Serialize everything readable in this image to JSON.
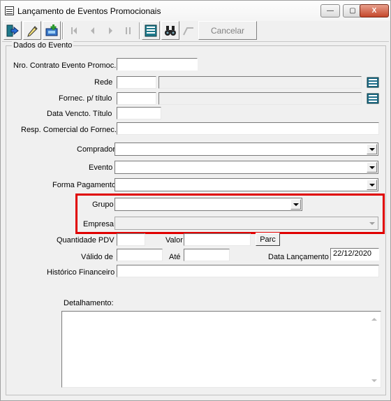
{
  "window": {
    "title": "Lançamento de Eventos Promocionais",
    "controls": {
      "minimize": "—",
      "maximize": "▢",
      "close": "X"
    }
  },
  "toolbar": {
    "icons": [
      "exit-icon",
      "edit-icon",
      "new-record-icon",
      "first-record-icon",
      "prev-record-icon",
      "next-record-icon",
      "last-record-icon",
      "list-view-icon",
      "binoculars-icon",
      "undo-icon"
    ],
    "cancel_label": "Cancelar"
  },
  "form": {
    "group_title": "Dados do Evento",
    "contrato_label": "Nro. Contrato Evento Promoc.",
    "contrato_value": "",
    "rede_label": "Rede",
    "rede_code": "",
    "rede_name": "",
    "fornec_label": "Fornec. p/ título",
    "fornec_code": "",
    "fornec_name": "",
    "data_venc_label": "Data Vencto. Título",
    "data_venc_value": "",
    "resp_label": "Resp. Comercial do Fornec.",
    "resp_value": "",
    "comprador_label": "Comprador",
    "comprador_value": "",
    "evento_label": "Evento",
    "evento_value": "",
    "forma_pag_label": "Forma Pagamento",
    "forma_pag_value": "",
    "grupo_label": "Grupo",
    "grupo_value": "",
    "empresa_label": "Empresa",
    "empresa_value": "",
    "qtd_pdv_label": "Quantidade PDV",
    "qtd_pdv_value": "",
    "valor_label": "Valor",
    "valor_value": "",
    "parc_label": "Parc",
    "valido_de_label": "Válido de",
    "valido_de_value": "",
    "ate_label": "Até",
    "ate_value": "",
    "data_lanc_label": "Data Lançamento",
    "data_lanc_value": "22/12/2020",
    "historico_label": "Histórico Financeiro",
    "historico_value": "",
    "detalhamento_label": "Detalhamento:",
    "detalhamento_value": ""
  },
  "colors": {
    "highlight_box": "#e00000",
    "window_bg": "#f0f0f0"
  }
}
